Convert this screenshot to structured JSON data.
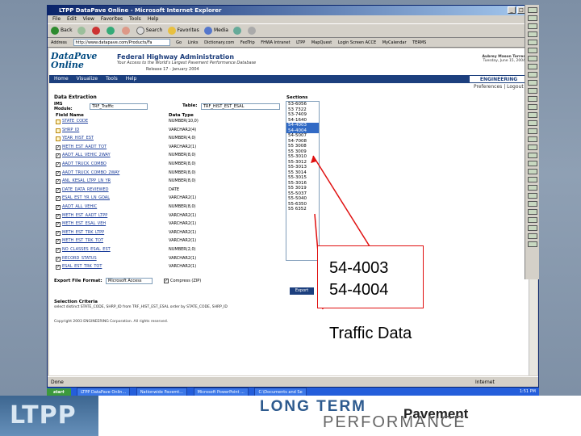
{
  "window": {
    "title": "LTPP DataPave Online - Microsoft Internet Explorer",
    "menu": [
      "File",
      "Edit",
      "View",
      "Favorites",
      "Tools",
      "Help"
    ]
  },
  "toolbar": {
    "back": "Back",
    "search": "Search",
    "favorites": "Favorites",
    "media": "Media"
  },
  "linksbar": {
    "address_label": "Address",
    "address_value": "http://www.datapave.com/Products/Fa",
    "go": "Go",
    "links_label": "Links",
    "links": [
      "Dictionary.com",
      "FedTrip",
      "FHWA Intranet",
      "LTPP",
      "MapQuest",
      "Login Screen ACCE",
      "MyCalendar",
      "TERMS"
    ]
  },
  "header": {
    "logo": "DataPave Online",
    "agency": "Federal Highway Administration",
    "tagline": "Your Access to the World's Largest Pavement Performance Database",
    "release": "Release 17 - January 2004",
    "user_name": "Aubrey Mason Torres",
    "user_date": "Tuesday, June 15, 2004",
    "nav": [
      "Home",
      "Visualize",
      "Tools",
      "Help"
    ],
    "engineering": "ENGINEERING",
    "preferences": "Preferences | Logout"
  },
  "form": {
    "section_title": "Data Extraction",
    "ims_label": "IMS Module:",
    "ims_value": "TRF_Traffic",
    "table_label": "Table:",
    "table_value": "TRF_HIST_EST_ESAL",
    "sections_label": "Sections",
    "field_header": "Field Name",
    "type_header": "Data Type",
    "fields": [
      {
        "name": "STATE_CODE",
        "type": "NUMBER(10,0)",
        "checked": false
      },
      {
        "name": "SHRP_ID",
        "type": "VARCHAR2(4)",
        "checked": false
      },
      {
        "name": "YEAR_HIST_EST",
        "type": "NUMBER(4,0)",
        "checked": false
      },
      {
        "name": "METH_EST_AADT_TOT",
        "type": "VARCHAR2(1)",
        "checked": true
      },
      {
        "name": "AADT_ALL_VEHIC_2WAY",
        "type": "NUMBER(8,0)",
        "checked": true
      },
      {
        "name": "AADT_TRUCK_COMBO",
        "type": "NUMBER(8,0)",
        "checked": true
      },
      {
        "name": "AADT_TRUCK_COMBO_2WAY",
        "type": "NUMBER(8,0)",
        "checked": true
      },
      {
        "name": "ANL_KESAL_LTPP_LN_YR",
        "type": "NUMBER(8,0)",
        "checked": true
      },
      {
        "name": "DATE_DATA_REVIEWED",
        "type": "DATE",
        "checked": true
      },
      {
        "name": "ESAL_EST_YR_LN_GOAL",
        "type": "VARCHAR2(1)",
        "checked": true
      },
      {
        "name": "AADT_ALL_VEHIC",
        "type": "NUMBER(8,0)",
        "checked": true
      },
      {
        "name": "METH_EST_AADT_LTPP",
        "type": "VARCHAR2(1)",
        "checked": true
      },
      {
        "name": "METH_EST_ESAL_VEH",
        "type": "VARCHAR2(1)",
        "checked": true
      },
      {
        "name": "METH_EST_TRK_LTPP",
        "type": "VARCHAR2(1)",
        "checked": true
      },
      {
        "name": "METH_EST_TRK_TOT",
        "type": "VARCHAR2(1)",
        "checked": true
      },
      {
        "name": "NO_CLASSES_ESAL_EST",
        "type": "NUMBER(2,0)",
        "checked": true
      },
      {
        "name": "RECORD_STATUS",
        "type": "VARCHAR2(1)",
        "checked": true
      },
      {
        "name": "ESAL_EST_TRK_TOT",
        "type": "VARCHAR2(1)",
        "checked": true
      }
    ],
    "sections": [
      {
        "id": "53-6056",
        "selected": false
      },
      {
        "id": "53 7322",
        "selected": false
      },
      {
        "id": "53-7409",
        "selected": false
      },
      {
        "id": "54-1640",
        "selected": false
      },
      {
        "id": "54-4003",
        "selected": true
      },
      {
        "id": "54-4004",
        "selected": true
      },
      {
        "id": "54-5007",
        "selected": false
      },
      {
        "id": "54-7008",
        "selected": false
      },
      {
        "id": "55 3008",
        "selected": false
      },
      {
        "id": "55 3009",
        "selected": false
      },
      {
        "id": "55-3010",
        "selected": false
      },
      {
        "id": "55-3012",
        "selected": false
      },
      {
        "id": "55-3013",
        "selected": false
      },
      {
        "id": "55 3014",
        "selected": false
      },
      {
        "id": "55-3015",
        "selected": false
      },
      {
        "id": "55-3016",
        "selected": false
      },
      {
        "id": "55 3019",
        "selected": false
      },
      {
        "id": "55-5037",
        "selected": false
      },
      {
        "id": "55-5040",
        "selected": false
      },
      {
        "id": "55-6350",
        "selected": false
      },
      {
        "id": "55 6352",
        "selected": false
      }
    ],
    "export_label": "Export File Format:",
    "export_value": "Microsoft Access",
    "compress_label": "Compress (ZIP)",
    "export_button": "Export",
    "criteria_label": "Selection Criteria",
    "criteria_sql": "select distinct STATE_CODE, SHRP_ID from TRF_HIST_EST_ESAL order by STATE_CODE, SHRP_ID",
    "copyright": "Copyright 2003 ENGINEERING Corporation. All rights reserved."
  },
  "statusbar": {
    "left": "Done",
    "right": "Internet"
  },
  "taskbar": {
    "start": "start",
    "tasks": [
      "LTPP DataPave Onlin...",
      "Nationwide Pavemt...",
      "Microsoft PowerPoint ...",
      "C:\\Documents and Se"
    ],
    "clock": "1:51 PM"
  },
  "annotation": {
    "line1": "54-4003",
    "line2": "54-4004",
    "label": "Traffic Data",
    "color": "#e01010"
  },
  "footer": {
    "ltpp": "LTPP",
    "long_term": "LONG TERM",
    "pavement": "Pavement",
    "performance": "PERFORMANCE"
  }
}
